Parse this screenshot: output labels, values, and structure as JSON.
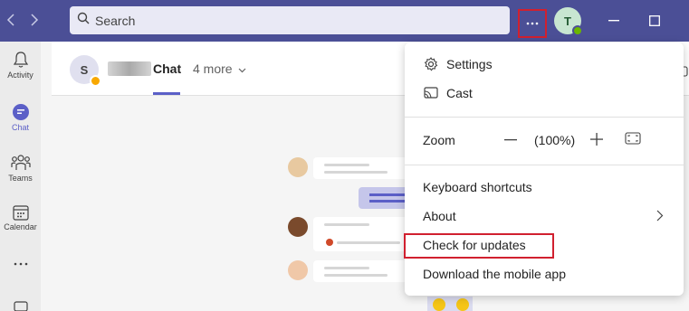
{
  "titlebar": {
    "search_placeholder": "Search",
    "avatar_initial": "T",
    "icons": [
      "back-arrow",
      "forward-arrow",
      "search-icon",
      "more-options-icon",
      "minimize-icon",
      "maximize-icon"
    ]
  },
  "rail": {
    "items": [
      {
        "label": "Activity",
        "icon": "bell-icon"
      },
      {
        "label": "Chat",
        "icon": "chat-icon",
        "active": true
      },
      {
        "label": "Teams",
        "icon": "teams-icon"
      },
      {
        "label": "Calendar",
        "icon": "calendar-icon"
      }
    ]
  },
  "chat_header": {
    "avatar_initial": "S",
    "tab_label": "Chat",
    "more_tabs_label": "4 more"
  },
  "menu": {
    "settings": "Settings",
    "cast": "Cast",
    "zoom_label": "Zoom",
    "zoom_value": "(100%)",
    "keyboard_shortcuts": "Keyboard shortcuts",
    "about": "About",
    "check_updates": "Check for updates",
    "download_mobile": "Download the mobile app"
  },
  "colors": {
    "titlebar": "#4b4f96",
    "accent": "#5b5fc7",
    "highlight_border": "#d1202f"
  }
}
